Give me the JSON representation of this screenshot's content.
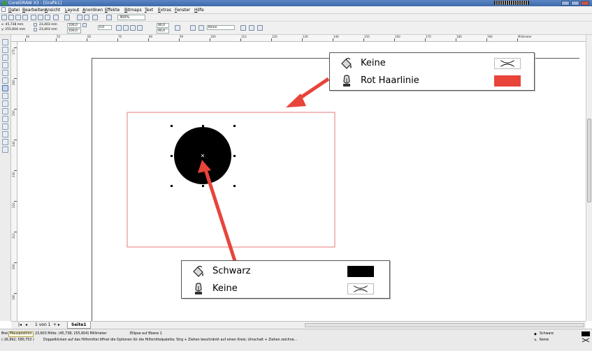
{
  "window": {
    "title": "CorelDRAW X3 - [Grafik1]"
  },
  "menu": {
    "items": [
      {
        "label": "Datei"
      },
      {
        "label": "Bearbeiten"
      },
      {
        "label": "Ansicht"
      },
      {
        "label": "Layout"
      },
      {
        "label": "Anordnen"
      },
      {
        "label": "Effekte"
      },
      {
        "label": "Bitmaps"
      },
      {
        "label": "Text"
      },
      {
        "label": "Extras"
      },
      {
        "label": "Fenster"
      },
      {
        "label": "Hilfe"
      }
    ]
  },
  "toolbar": {
    "zoom_value": "300%"
  },
  "properties": {
    "x": "x: 45,738 mm",
    "y": "y: 255,604 mm",
    "width": "23,403 mm",
    "height": "23,403 mm",
    "scale_x": "100,0",
    "scale_y": "100,0",
    "rotation": "0,0",
    "angle_start": "90,0",
    "angle_end": "90,0",
    "outline": "Keine"
  },
  "ruler": {
    "h_labels": [
      "40",
      "50",
      "60",
      "70",
      "80",
      "90",
      "100",
      "110",
      "120",
      "130",
      "140",
      "150",
      "160",
      "170",
      "180",
      "190",
      "Millimeter"
    ],
    "v_labels": [
      "270",
      "260",
      "250",
      "240",
      "230",
      "220",
      "210",
      "200",
      "190"
    ]
  },
  "callout_top": {
    "fill_label": "Keine",
    "outline_label": "Rot Haarlinie",
    "fill_swatch": "none",
    "outline_color": "#e8443a"
  },
  "callout_bottom": {
    "fill_label": "Schwarz",
    "outline_label": "Keine",
    "fill_color": "#000000",
    "outline_swatch": "none"
  },
  "colors": {
    "arrow": "#e8443a",
    "page_frame": "#e87a7a",
    "selection": "#000000"
  },
  "page_tabs": {
    "counter": "1 von 1",
    "tab": "Seite1"
  },
  "status": {
    "line1_prefix": "Brei",
    "mouse_badge": "Mausposition",
    "line1": "23,603 Mitte: (45,738; 255,604) Millimeter",
    "object": "Ellipse auf Ebene 1",
    "line2_coords": "(-16,992; 580,753 )",
    "line2": "Doppelklicken auf das Hilfsmittel öffnet die Optionen für die Hilfsmittelpalette; Strg + Ziehen beschränkt auf einen Kreis; Umschalt + Ziehen zeichne...",
    "fill_indicator": "Schwarz",
    "outline_indicator": "Keine"
  }
}
